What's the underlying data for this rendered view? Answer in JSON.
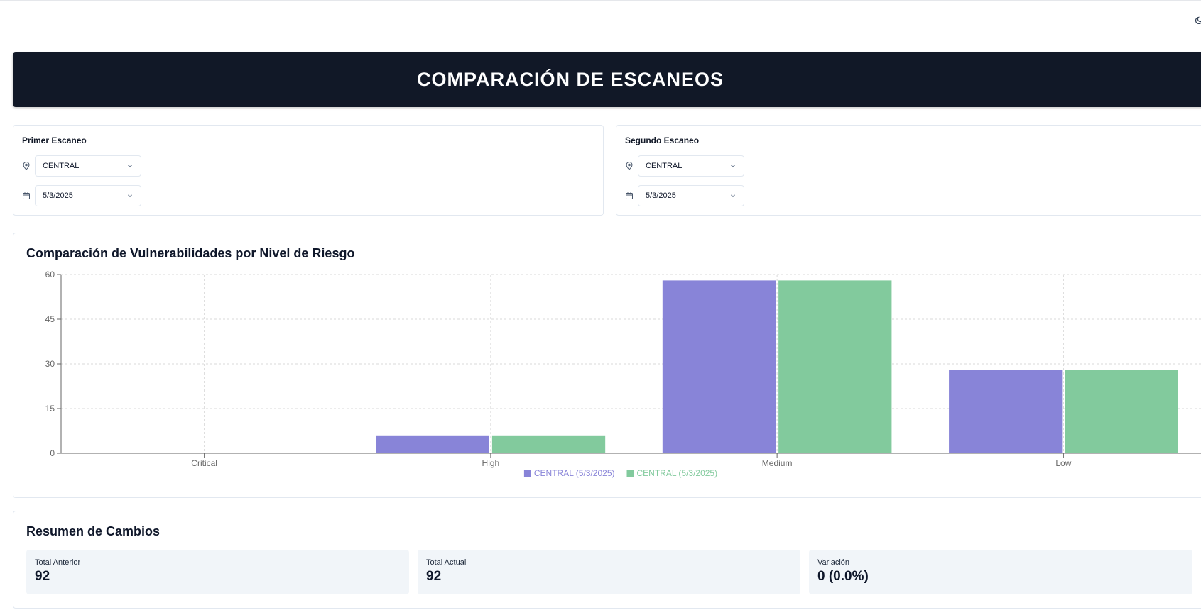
{
  "header": {
    "title": "COMPARACIÓN DE ESCANEOS"
  },
  "first_scan": {
    "title": "Primer Escaneo",
    "location": "CENTRAL",
    "date": "5/3/2025",
    "location_icon": "map-pin-icon",
    "date_icon": "calendar-icon"
  },
  "second_scan": {
    "title": "Segundo Escaneo",
    "location": "CENTRAL",
    "date": "5/3/2025",
    "location_icon": "map-pin-icon",
    "date_icon": "calendar-icon"
  },
  "chart_section": {
    "title": "Comparación de Vulnerabilidades por Nivel de Riesgo"
  },
  "chart_data": {
    "type": "bar",
    "categories": [
      "Critical",
      "High",
      "Medium",
      "Low"
    ],
    "series": [
      {
        "name": "CENTRAL (5/3/2025)",
        "values": [
          0,
          6,
          58,
          28
        ],
        "color": "#8884d8"
      },
      {
        "name": "CENTRAL (5/3/2025)",
        "values": [
          0,
          6,
          58,
          28
        ],
        "color": "#82ca9d"
      }
    ],
    "yticks": [
      0,
      15,
      30,
      45,
      60
    ],
    "ylim": [
      0,
      60
    ],
    "grid": true,
    "legend": "bottom-center"
  },
  "summary": {
    "title": "Resumen de Cambios",
    "previous_label": "Total Anterior",
    "previous_value": "92",
    "current_label": "Total Actual",
    "current_value": "92",
    "variation_label": "Variación",
    "variation_value": "0 (0.0%)"
  },
  "colors": {
    "header_bg": "#111827",
    "series_1": "#8884d8",
    "series_2": "#82ca9d",
    "stat_bg": "#f1f5f9"
  }
}
